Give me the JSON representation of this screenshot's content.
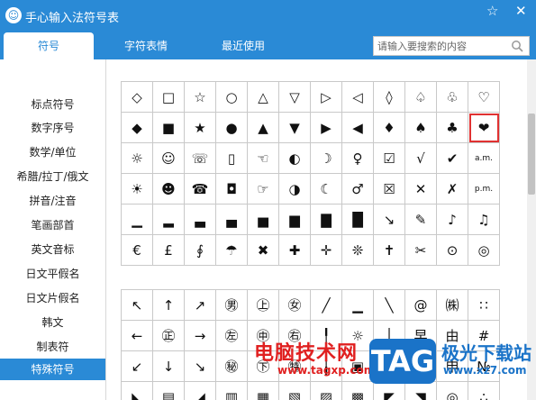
{
  "app": {
    "title": "手心输入法符号表",
    "logo_glyph": "☺",
    "pin_glyph": "☆",
    "close_glyph": "✕"
  },
  "tabs": [
    {
      "label": "符号",
      "active": true
    },
    {
      "label": "字符表情",
      "active": false
    },
    {
      "label": "最近使用",
      "active": false
    }
  ],
  "search": {
    "placeholder": "请输入要搜索的内容",
    "value": ""
  },
  "sidebar": {
    "items": [
      {
        "label": "标点符号",
        "active": false
      },
      {
        "label": "数字序号",
        "active": false
      },
      {
        "label": "数学/单位",
        "active": false
      },
      {
        "label": "希腊/拉丁/俄文",
        "active": false
      },
      {
        "label": "拼音/注音",
        "active": false
      },
      {
        "label": "笔画部首",
        "active": false
      },
      {
        "label": "英文音标",
        "active": false
      },
      {
        "label": "日文平假名",
        "active": false
      },
      {
        "label": "日文片假名",
        "active": false
      },
      {
        "label": "韩文",
        "active": false
      },
      {
        "label": "制表符",
        "active": false
      },
      {
        "label": "特殊符号",
        "active": true
      }
    ]
  },
  "grid1": [
    [
      "◇",
      "□",
      "☆",
      "○",
      "△",
      "▽",
      "▷",
      "◁",
      "◊",
      "♤",
      "♧",
      "♡"
    ],
    [
      "◆",
      "■",
      "★",
      "●",
      "▲",
      "▼",
      "▶",
      "◀",
      "♦",
      "♠",
      "♣",
      "❤"
    ],
    [
      "☼",
      "☺",
      "☏",
      "▯",
      "☜",
      "◐",
      "☽",
      "♀",
      "☑",
      "√",
      "✔",
      "a.m."
    ],
    [
      "☀",
      "☻",
      "☎",
      "◘",
      "☞",
      "◑",
      "☾",
      "♂",
      "☒",
      "✕",
      "✗",
      "p.m."
    ],
    [
      "▁",
      "▂",
      "▃",
      "▄",
      "▅",
      "▆",
      "▇",
      "█",
      "↘",
      "✎",
      "♪",
      "♫"
    ],
    [
      "€",
      "£",
      "∮",
      "☂",
      "✖",
      "✚",
      "✛",
      "❊",
      "✝",
      "✂",
      "⊙",
      "◎"
    ]
  ],
  "grid2": [
    [
      "↖",
      "↑",
      "↗",
      "㊚",
      "㊤",
      "㊛",
      "╱",
      "▁",
      "╲",
      "@",
      "㈱",
      "∷"
    ],
    [
      "←",
      "㊣",
      "→",
      "㊧",
      "㊥",
      "㊨",
      "╿",
      "☼",
      "│",
      "早",
      "由",
      "#"
    ],
    [
      "↙",
      "↓",
      "↘",
      "㊙",
      "㊦",
      "㊕",
      "╽",
      "▣",
      "▓",
      "甲",
      "申",
      "№"
    ],
    [
      "◣",
      "▤",
      "◢",
      "▥",
      "▦",
      "▧",
      "▨",
      "▩",
      "◤",
      "◥",
      "◎",
      "∴"
    ]
  ],
  "watermark": {
    "cn": "电脑技术网",
    "url": "www.tagxp.com",
    "tag": "TAG",
    "tag_cn": "极光下载站",
    "url2": "www.xz7.com"
  },
  "colors": {
    "accent": "#2a8ad6",
    "highlight": "#e03131"
  }
}
